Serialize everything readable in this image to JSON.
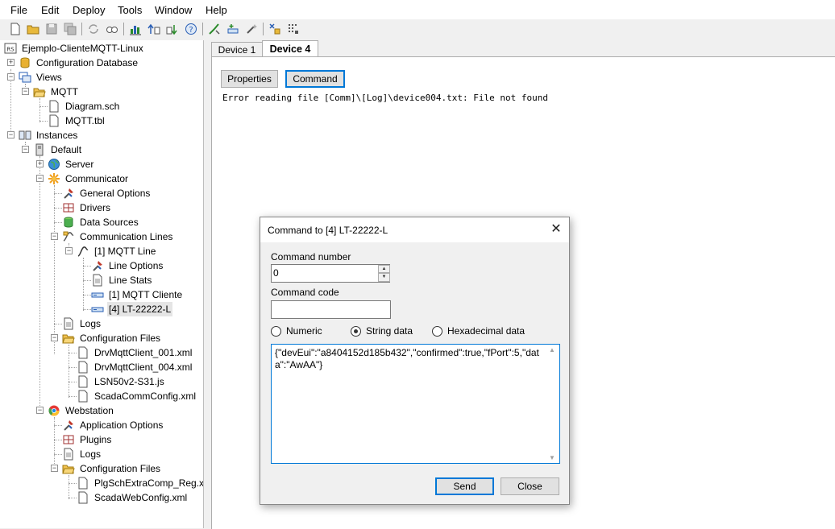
{
  "menu": [
    "File",
    "Edit",
    "Deploy",
    "Tools",
    "Window",
    "Help"
  ],
  "toolbar": {
    "icons": [
      "new-icon",
      "open-icon",
      "save-icon",
      "save-all-icon",
      "refresh-icon",
      "find-icon",
      "chart-icon",
      "upload-icon",
      "download-icon",
      "help-icon",
      "deploy-icon",
      "add-line-icon",
      "wand-icon",
      "settings-icon",
      "grid-icon"
    ]
  },
  "tree": {
    "root": "Ejemplo-ClienteMQTT-Linux",
    "config_db": "Configuration Database",
    "views": "Views",
    "mqtt": "MQTT",
    "diagram": "Diagram.sch",
    "mqtt_tbl": "MQTT.tbl",
    "instances": "Instances",
    "default": "Default",
    "server": "Server",
    "communicator": "Communicator",
    "general_options": "General Options",
    "drivers": "Drivers",
    "data_sources": "Data Sources",
    "comm_lines": "Communication Lines",
    "mqtt_line": "[1] MQTT Line",
    "line_options": "Line Options",
    "line_stats": "Line Stats",
    "mqtt_cliente": "[1] MQTT Cliente",
    "lt_device": "[4] LT-22222-L",
    "logs": "Logs",
    "config_files": "Configuration Files",
    "file1": "DrvMqttClient_001.xml",
    "file2": "DrvMqttClient_004.xml",
    "file3": "LSN50v2-S31.js",
    "file4": "ScadaCommConfig.xml",
    "webstation": "Webstation",
    "app_options": "Application Options",
    "plugins": "Plugins",
    "logs2": "Logs",
    "config_files2": "Configuration Files",
    "file5": "PlgSchExtraComp_Reg.xml",
    "file6": "ScadaWebConfig.xml"
  },
  "tabs": {
    "tab1": "Device 1",
    "tab2": "Device 4"
  },
  "content": {
    "properties_label": "Properties",
    "command_label": "Command",
    "output": "Error reading file [Comm]\\[Log]\\device004.txt: File not found"
  },
  "dialog": {
    "title": "Command to [4] LT-22222-L",
    "cmd_number_label": "Command number",
    "cmd_number_value": "0",
    "cmd_code_label": "Command code",
    "cmd_code_value": "",
    "radio_numeric": "Numeric",
    "radio_string": "String data",
    "radio_hex": "Hexadecimal data",
    "selected_radio": "String data",
    "data_text": "{\"devEui\":\"a8404152d185b432\",\"confirmed\":true,\"fPort\":5,\"data\":\"AwAA\"}",
    "send_label": "Send",
    "close_label": "Close"
  }
}
